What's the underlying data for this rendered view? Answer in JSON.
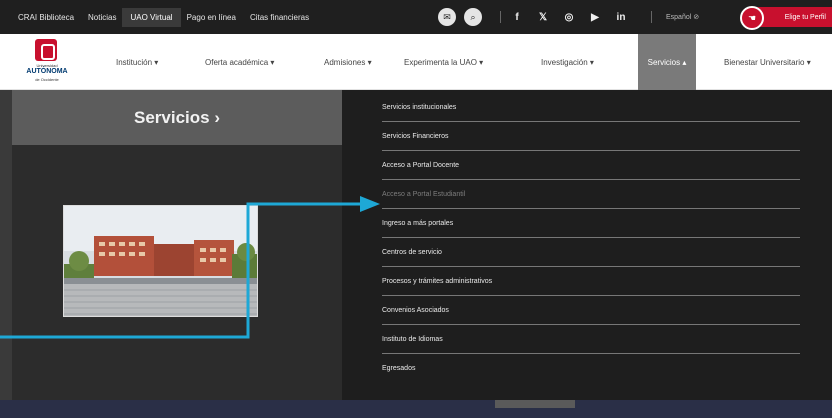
{
  "topbar": {
    "links": [
      "CRAI Biblioteca",
      "Noticias",
      "UAO Virtual",
      "Pago en línea",
      "Citas financieras"
    ],
    "language": "Español ⊘",
    "perfil_label": "Elige tu Perfil",
    "social": [
      "f",
      "𝕏",
      "◎",
      "▶",
      "in"
    ]
  },
  "logo": {
    "line1": "Universidad",
    "line2": "AUTÓNOMA",
    "line3": "de Occidente"
  },
  "nav": {
    "items": [
      "Institución ▾",
      "Oferta académica ▾",
      "Admisiones ▾",
      "Experimenta la UAO ▾",
      "Investigación ▾",
      "Servicios ▴",
      "Bienestar Universitario ▾"
    ]
  },
  "hero": {
    "title": "Servicios ›"
  },
  "dropdown": {
    "items": [
      "Servicios institucionales",
      "Servicios Financieros",
      "Acceso a Portal Docente",
      "Acceso a Portal Estudiantil",
      "Ingreso a más portales",
      "Centros de servicio",
      "Procesos y trámites administrativos",
      "Convenios Asociados",
      "Instituto de Idiomas",
      "Egresados"
    ]
  },
  "colors": {
    "brand_red": "#c8102e",
    "annotation": "#1ea8d6",
    "active_nav": "#7a7a7a"
  }
}
